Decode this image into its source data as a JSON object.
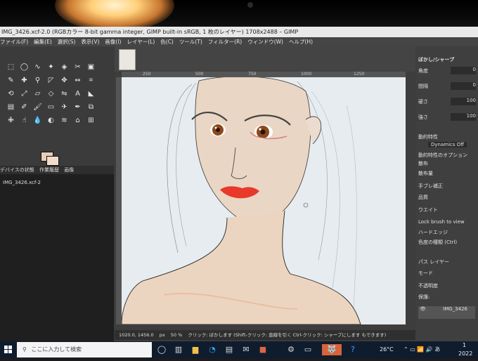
{
  "window": {
    "title": "IMG_3426.xcf-2.0 (RGBカラー 8-bit gamma integer, GIMP built-in sRGB, 1 枚のレイヤー) 1708x2488 – GIMP"
  },
  "menu": [
    "ファイル(F)",
    "編集(E)",
    "選択(S)",
    "表示(V)",
    "画像(I)",
    "レイヤー(L)",
    "色(C)",
    "ツール(T)",
    "フィルター(R)",
    "ウィンドウ(W)",
    "ヘルプ(H)"
  ],
  "toolbox": {
    "tool_icons": [
      "rect-select-icon",
      "ellipse-select-icon",
      "lasso-icon",
      "fuzzy-select-icon",
      "color-select-icon",
      "scissors-icon",
      "foreground-select-icon",
      "paths-icon",
      "color-picker-icon",
      "zoom-icon",
      "measure-icon",
      "move-icon",
      "align-icon",
      "crop-icon",
      "rotate-icon",
      "scale-icon",
      "shear-icon",
      "perspective-icon",
      "flip-icon",
      "text-icon",
      "bucket-fill-icon",
      "gradient-icon",
      "pencil-icon",
      "paintbrush-icon",
      "eraser-icon",
      "airbrush-icon",
      "ink-icon",
      "clone-icon",
      "heal-icon",
      "smudge-icon",
      "blur-icon",
      "dodge-icon",
      "warp-icon",
      "cage-icon",
      "unified-transform-icon"
    ],
    "tool_glyphs": [
      "⬚",
      "◯",
      "∿",
      "✦",
      "◈",
      "✂",
      "▣",
      "✎",
      "✚",
      "⚲",
      "◸",
      "✥",
      "⇔",
      "⌗",
      "⟲",
      "⤢",
      "▱",
      "◇",
      "⇋",
      "A",
      "◣",
      "▤",
      "✐",
      "🖌",
      "▭",
      "✈",
      "✒",
      "⧉",
      "✙",
      "☝",
      "💧",
      "◐",
      "≋",
      "⌂",
      "⊞"
    ],
    "fg_color": "#e9cdb6",
    "bg_color": "#f1dccb",
    "tabs": [
      "デバイスの状態",
      "作業履歴",
      "画像"
    ],
    "image_list_item": "IMG_3426.xcf-2"
  },
  "canvas": {
    "ruler_ticks": [
      "250",
      "500",
      "750",
      "1000",
      "1250"
    ]
  },
  "status": {
    "coords": "1020.0, 1456.0",
    "unit": "px",
    "zoom": "50 %",
    "hint": "クリック: ぼかします (Shift-クリック: 直線を引く Ctrl-クリック: シャープにします もできます)"
  },
  "dock": {
    "title": "ぼかし/シャープ",
    "rows": [
      {
        "label": "角度",
        "value": "0"
      },
      {
        "label": "間隔",
        "value": "0"
      },
      {
        "label": "硬さ",
        "value": "100"
      },
      {
        "label": "強さ",
        "value": "100"
      }
    ],
    "dynamics_label": "動的特性",
    "dynamics_value": "Dynamics Off",
    "dynamics_options": "動的特性のオプション",
    "scatter": "散布",
    "scatter_amount": "散布量",
    "jitter": "手ブレ補正",
    "quality": "品質",
    "weight": "ウエイト",
    "lock_brush": "Lock brush to view",
    "hard_edge": "ハードエッジ",
    "blur_type": "色度の種類 (Ctrl)",
    "layer_tabs": [
      "パス",
      "レイヤー"
    ],
    "mode": "モード",
    "opacity": "不透明度",
    "protect": "保護:",
    "layer_name": "IMG_3426"
  },
  "taskbar": {
    "search_placeholder": "ここに入力して検索",
    "temperature": "26°C",
    "time": "1",
    "date": "2022"
  }
}
